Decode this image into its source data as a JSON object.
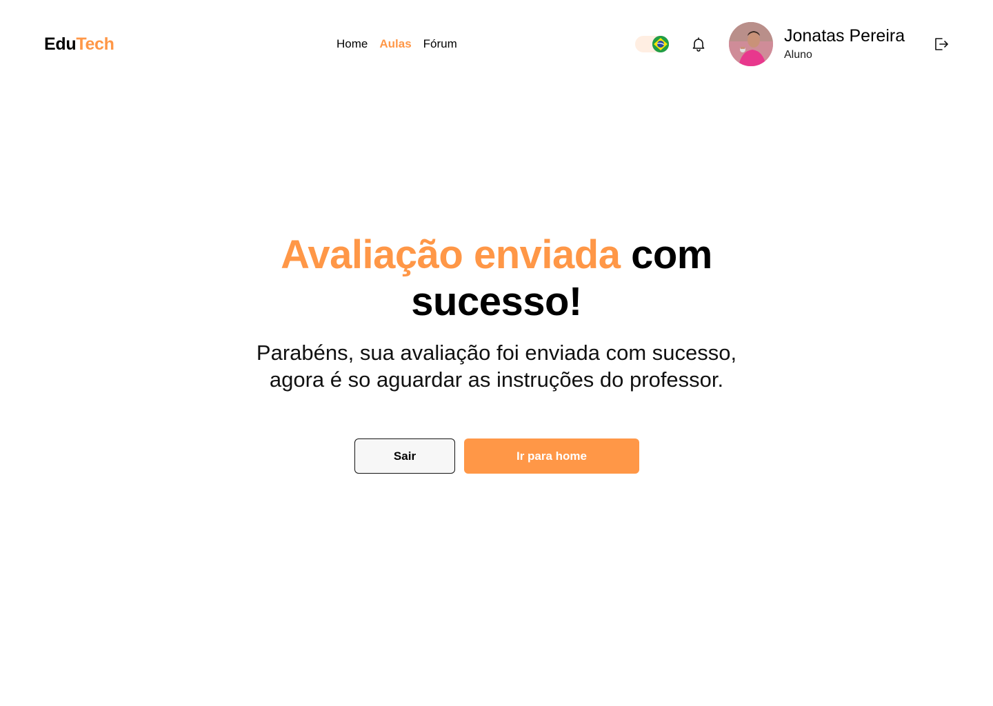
{
  "header": {
    "logo": {
      "part1": "Edu",
      "part2": "Tech"
    },
    "nav": [
      {
        "label": "Home",
        "active": false
      },
      {
        "label": "Aulas",
        "active": true
      },
      {
        "label": "Fórum",
        "active": false
      }
    ],
    "language_toggle": {
      "flag_icon": "brazil-flag-icon"
    },
    "notification_icon": "bell-icon",
    "user": {
      "name": "Jonatas Pereira",
      "role": "Aluno"
    },
    "logout_icon": "logout-icon"
  },
  "main": {
    "headline_accent": "Avaliação enviada",
    "headline_rest": "com sucesso!",
    "subtitle": "Parabéns, sua avaliação foi enviada com sucesso, agora é so aguardar as instruções do professor.",
    "buttons": {
      "secondary": "Sair",
      "primary": "Ir para home"
    }
  },
  "colors": {
    "accent": "#FF9747",
    "toggle_bg": "#FFEEE2",
    "text": "#000000"
  }
}
